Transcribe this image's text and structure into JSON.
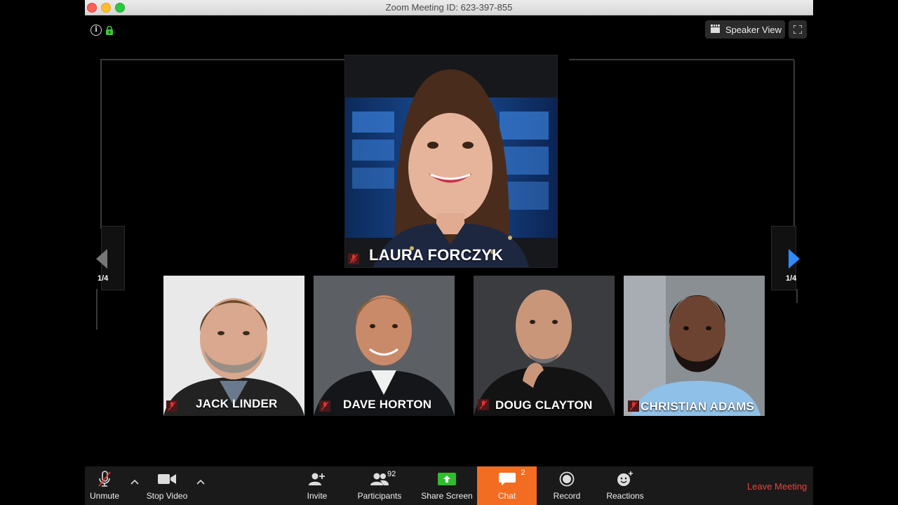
{
  "window": {
    "title": "Zoom Meeting ID: 623-397-855"
  },
  "view_toggle": {
    "label": "Speaker View"
  },
  "pagination": {
    "left": "1/4",
    "right": "1/4"
  },
  "main_speaker": {
    "name": "LAURA FORCZYK"
  },
  "participants": [
    {
      "name": "JACK LINDER"
    },
    {
      "name": "DAVE HORTON"
    },
    {
      "name": "DOUG CLAYTON"
    },
    {
      "name": "CHRISTIAN ADAMS"
    }
  ],
  "toolbar": {
    "unmute": "Unmute",
    "stop_video": "Stop Video",
    "invite": "Invite",
    "participants": "Participants",
    "participants_count": "92",
    "share_screen": "Share Screen",
    "chat": "Chat",
    "chat_count": "2",
    "record": "Record",
    "reactions": "Reactions",
    "leave": "Leave Meeting"
  },
  "colors": {
    "chat_accent": "#f26d21",
    "leave": "#e8453c",
    "share": "#2dbd2d",
    "nav_arrow": "#2d8cff"
  }
}
